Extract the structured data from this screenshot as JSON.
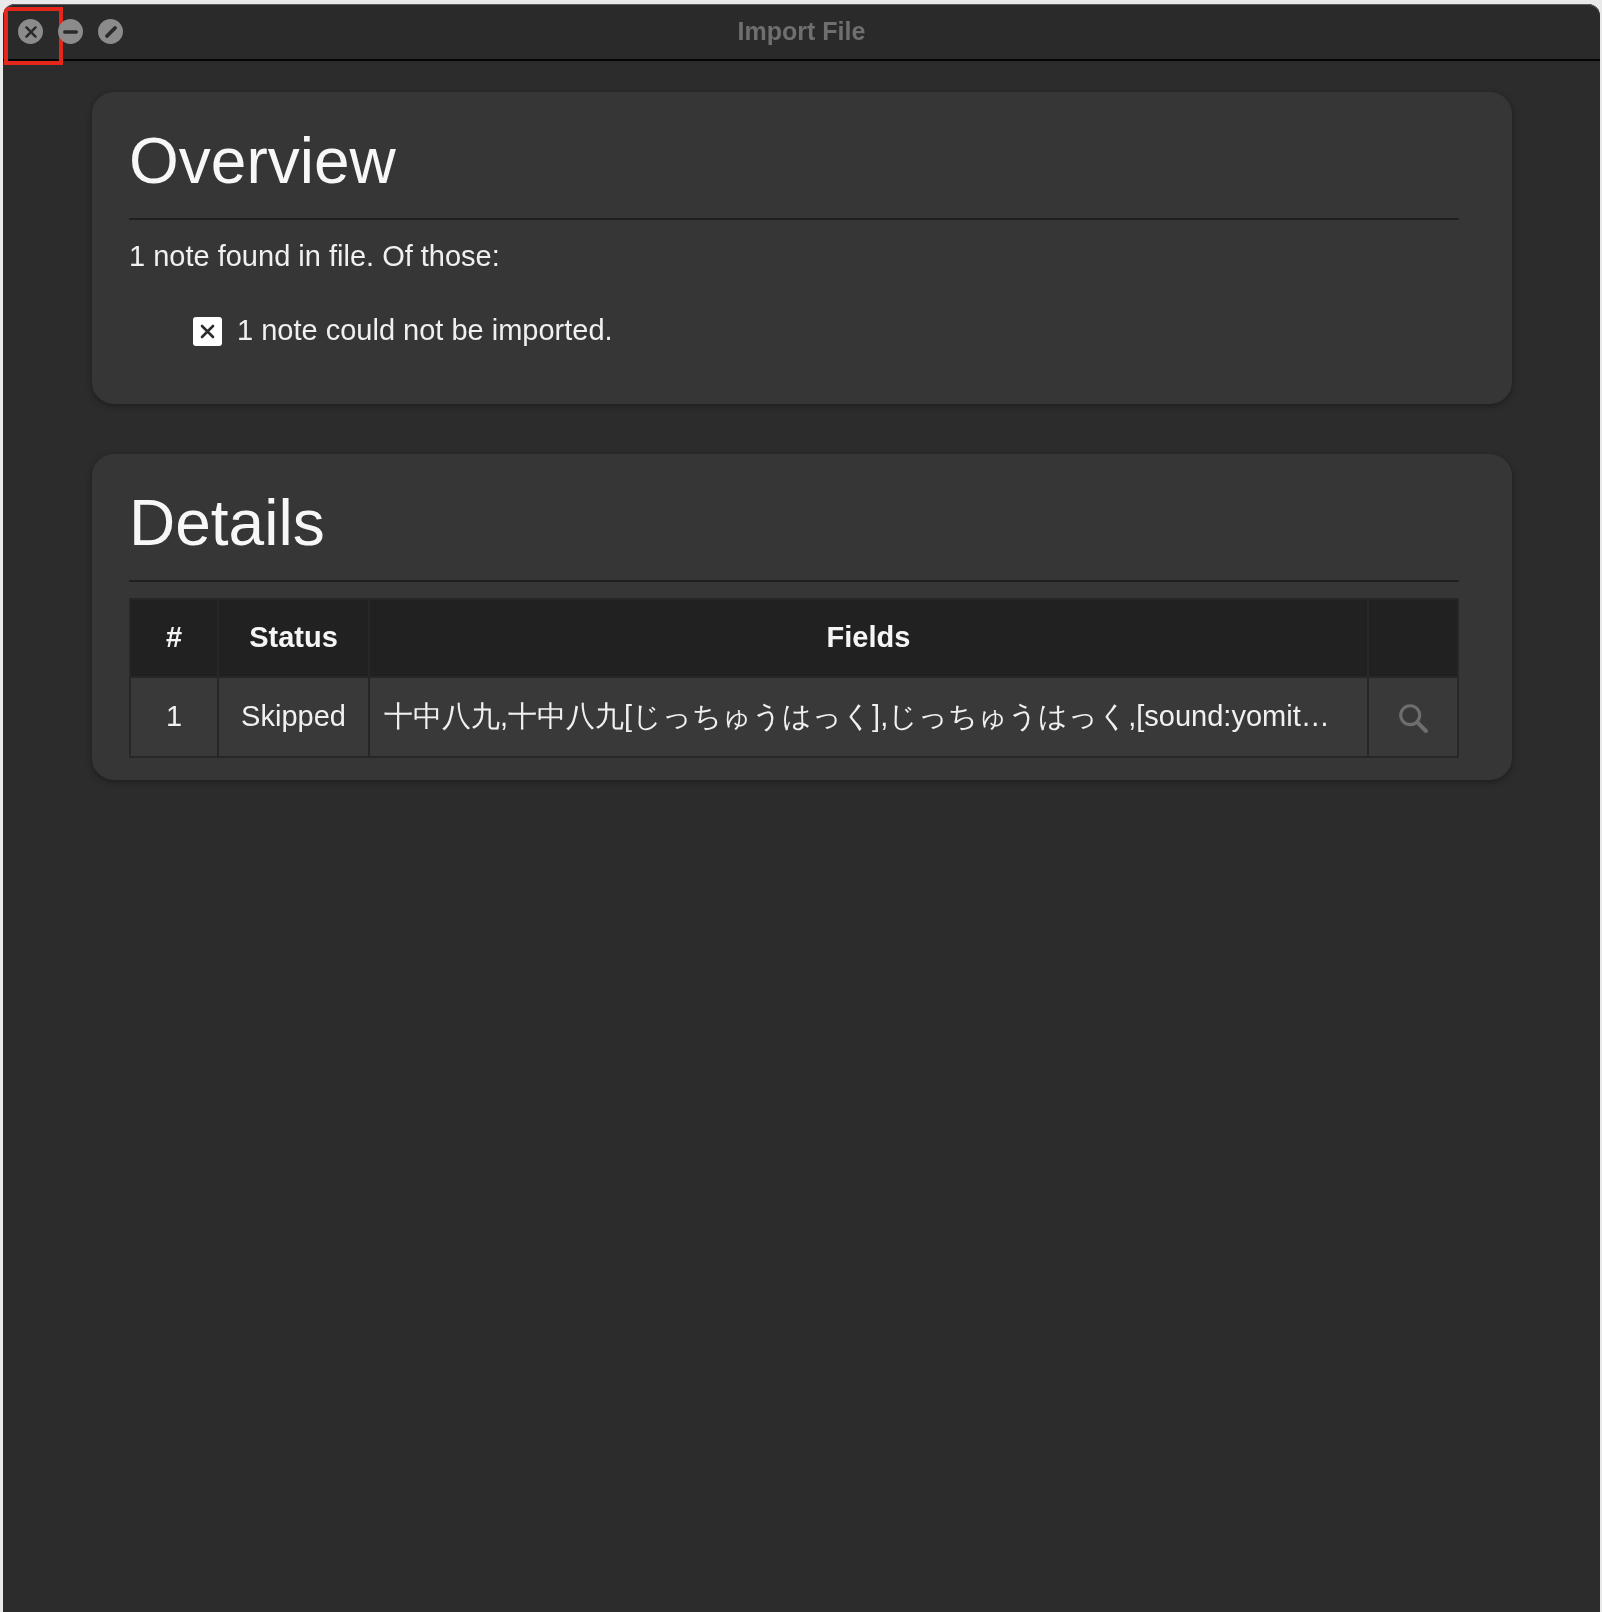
{
  "window": {
    "title": "Import File",
    "controls": [
      {
        "kind": "close",
        "highlighted": true
      },
      {
        "kind": "minimize",
        "highlighted": false
      },
      {
        "kind": "fullscreen",
        "highlighted": false
      }
    ]
  },
  "overview": {
    "title": "Overview",
    "summary": "1 note found in file. Of those:",
    "results": [
      {
        "kind": "failed",
        "text": "1 note could not be imported."
      }
    ]
  },
  "details": {
    "title": "Details",
    "table": {
      "columns": [
        "#",
        "Status",
        "Fields"
      ],
      "rows": [
        {
          "cells": [
            "1",
            "Skipped",
            "十中八九,十中八九[じっちゅうはっく],じっちゅうはっく,[sound:yomit…"
          ]
        }
      ]
    }
  }
}
